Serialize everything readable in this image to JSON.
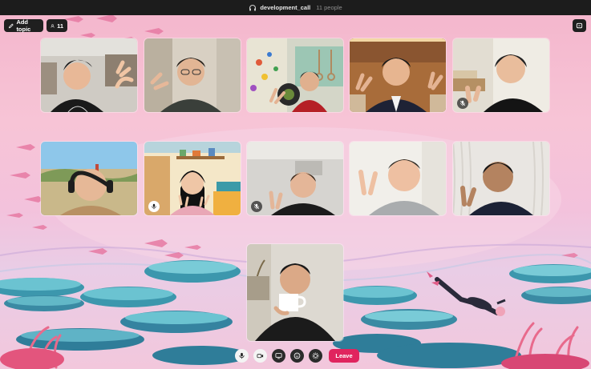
{
  "titlebar": {
    "icon": "headphones-icon",
    "channel": "development_call",
    "people": "11 people"
  },
  "toolbar": {
    "add_topic_label": "Add topic",
    "participant_count": "11",
    "chat_icon": "chat-bubble-icon"
  },
  "participants": [
    {
      "id": 1,
      "muted": false
    },
    {
      "id": 2,
      "muted": false
    },
    {
      "id": 3,
      "muted": false
    },
    {
      "id": 4,
      "muted": false
    },
    {
      "id": 5,
      "muted": true
    },
    {
      "id": 6,
      "muted": false
    },
    {
      "id": 7,
      "muted": false,
      "mic_badge": true
    },
    {
      "id": 8,
      "muted": true
    },
    {
      "id": 9,
      "muted": false
    },
    {
      "id": 10,
      "muted": false
    },
    {
      "id": 11,
      "muted": false
    }
  ],
  "controls": {
    "mic": "microphone-icon",
    "video": "video-camera-icon",
    "screen": "screen-share-icon",
    "emoji": "emoji-icon",
    "settings": "gear-icon",
    "leave_label": "Leave"
  },
  "colors": {
    "leave": "#e0245e",
    "background_pink": "#f4b7cd",
    "coral_teal": "#3fa3b8"
  }
}
